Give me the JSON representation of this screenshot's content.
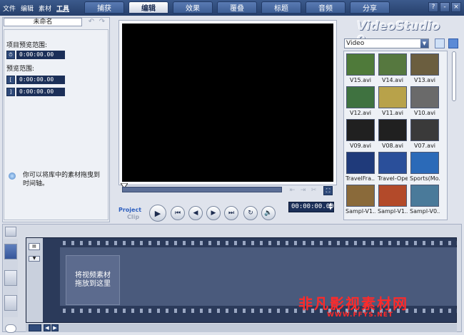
{
  "menu": {
    "items": [
      "文件",
      "编辑",
      "素材",
      "工具"
    ],
    "active_index": 3
  },
  "tabs": [
    {
      "label": "捕获",
      "active": false
    },
    {
      "label": "编辑",
      "active": true
    },
    {
      "label": "效果",
      "active": false
    },
    {
      "label": "覆叠",
      "active": false
    },
    {
      "label": "标题",
      "active": false
    },
    {
      "label": "音频",
      "active": false
    },
    {
      "label": "分享",
      "active": false
    }
  ],
  "window_buttons": {
    "help": "?",
    "minimize": "-",
    "close": "×"
  },
  "project": {
    "name": "未命名"
  },
  "options": {
    "project_range_label": "项目预览范围:",
    "project_range_value": "0:00:00.00",
    "preview_range_label": "预览范围:",
    "preview_start_value": "0:00:00.00",
    "preview_end_value": "0:00:00.00",
    "hint": "你可以将库中的素材拖曳到时间轴。"
  },
  "preview": {
    "mode_project": "Project",
    "mode_clip": "Clip",
    "timecode": "00:00:00.00"
  },
  "brand": {
    "text": "VideoStudio 9"
  },
  "library": {
    "category": "Video",
    "items": [
      {
        "label": "V15.avi",
        "color": "#4f7a3a"
      },
      {
        "label": "V14.avi",
        "color": "#56783f"
      },
      {
        "label": "V13.avi",
        "color": "#6b5e3f"
      },
      {
        "label": "V12.avi",
        "color": "#3f7240"
      },
      {
        "label": "V11.avi",
        "color": "#b8a24a"
      },
      {
        "label": "V10.avi",
        "color": "#6a6a6a"
      },
      {
        "label": "V09.avi",
        "color": "#202020"
      },
      {
        "label": "V08.avi",
        "color": "#202020"
      },
      {
        "label": "V07.avi",
        "color": "#3a3a3a"
      },
      {
        "label": "TravelFra...",
        "color": "#1f3a7a"
      },
      {
        "label": "Travel-Ope...",
        "color": "#2a4f9a"
      },
      {
        "label": "Sports(Mo...",
        "color": "#2b6ab8"
      },
      {
        "label": "Sampl-V1...",
        "color": "#8a6a3a"
      },
      {
        "label": "Sampl-V1...",
        "color": "#b34a2a"
      },
      {
        "label": "Sampl-V0...",
        "color": "#4a7a9a"
      }
    ]
  },
  "timeline": {
    "drop_hint": "将视频素材\n拖放到这里"
  },
  "watermark": {
    "text": "非凡影视素材网",
    "url": "WWW.FFYS.NET"
  }
}
